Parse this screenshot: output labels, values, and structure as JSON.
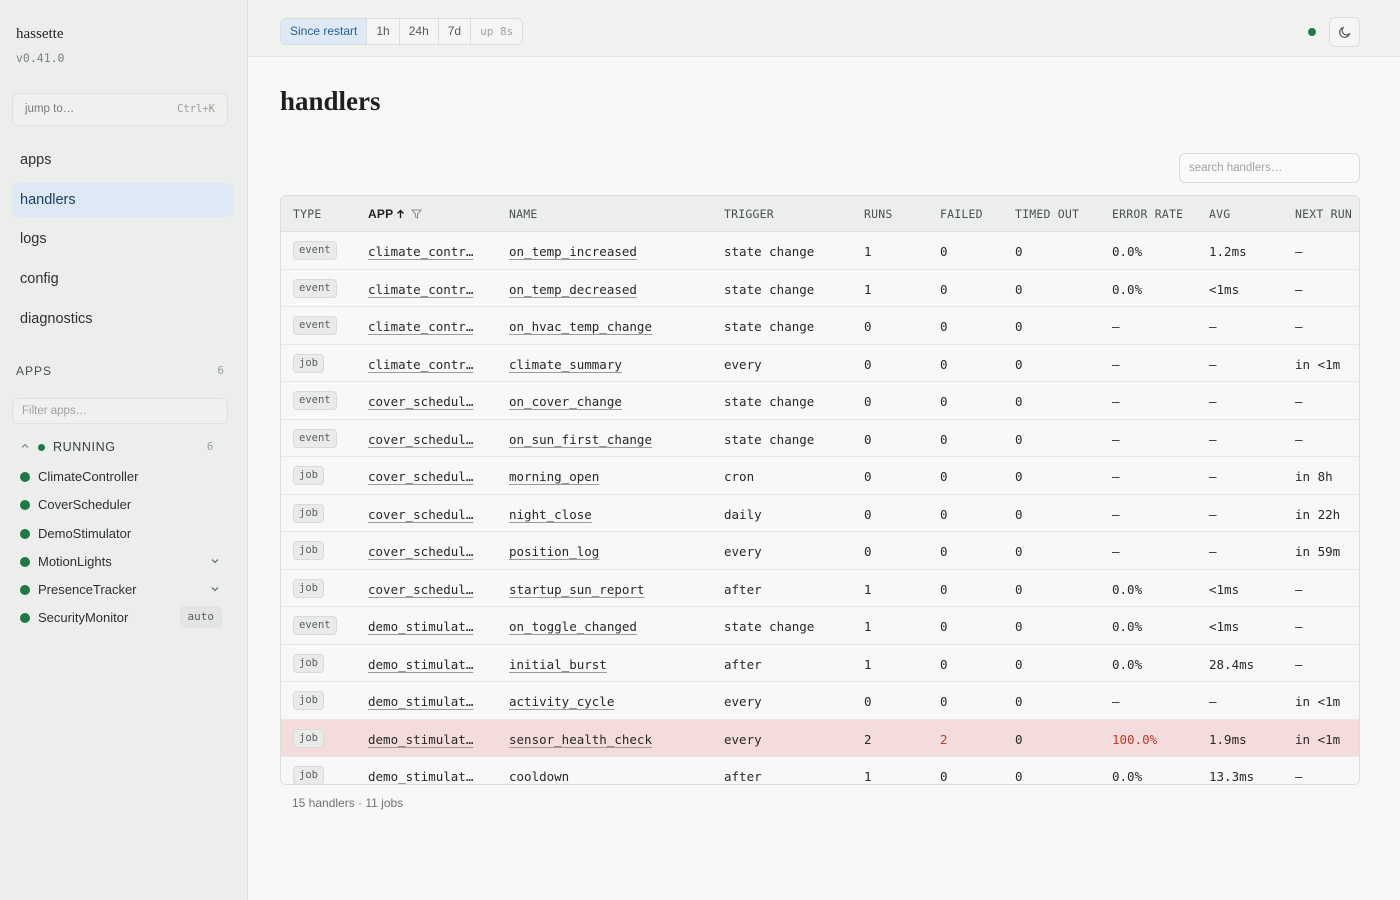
{
  "sidebar": {
    "brand": "hassette",
    "version": "v0.41.0",
    "jump_placeholder": "jump to…",
    "jump_shortcut": "Ctrl+K",
    "nav": [
      {
        "label": "apps",
        "active": false
      },
      {
        "label": "handlers",
        "active": true
      },
      {
        "label": "logs",
        "active": false
      },
      {
        "label": "config",
        "active": false
      },
      {
        "label": "diagnostics",
        "active": false
      }
    ],
    "apps_header": "APPS",
    "apps_count": "6",
    "filter_placeholder": "Filter apps…",
    "group": {
      "label": "RUNNING",
      "count": "6",
      "collapse_icon": "chevron-up-icon"
    },
    "apps": [
      {
        "name": "ClimateController",
        "status_color": "#1e7a45",
        "expand": false,
        "badge": ""
      },
      {
        "name": "CoverScheduler",
        "status_color": "#1e7a45",
        "expand": false,
        "badge": ""
      },
      {
        "name": "DemoStimulator",
        "status_color": "#1e7a45",
        "expand": false,
        "badge": ""
      },
      {
        "name": "MotionLights",
        "status_color": "#1e7a45",
        "expand": true,
        "badge": ""
      },
      {
        "name": "PresenceTracker",
        "status_color": "#1e7a45",
        "expand": true,
        "badge": ""
      },
      {
        "name": "SecurityMonitor",
        "status_color": "#1e7a45",
        "expand": false,
        "badge": "auto"
      }
    ]
  },
  "topbar": {
    "ranges": [
      "Since restart",
      "1h",
      "24h",
      "7d"
    ],
    "active_range": "Since restart",
    "uptime": "up 8s",
    "connection_color": "#1e7a45",
    "theme_icon": "moon-icon"
  },
  "page": {
    "title": "handlers",
    "search_placeholder": "search handlers…",
    "footer": "15 handlers · 11 jobs"
  },
  "table": {
    "columns": [
      "TYPE",
      "APP",
      "NAME",
      "TRIGGER",
      "RUNS",
      "FAILED",
      "TIMED OUT",
      "ERROR RATE",
      "AVG",
      "NEXT RUN"
    ],
    "sorted_column": "APP",
    "sort_icon": "arrow-up-icon",
    "filter_icon": "filter-icon",
    "error_color": "#c0392b",
    "rows": [
      {
        "type": "event",
        "app": "climate_contr…",
        "name": "on_temp_increased",
        "trigger": "state change",
        "runs": "1",
        "failed": "0",
        "timed_out": "0",
        "error_rate": "0.0%",
        "avg": "1.2ms",
        "next_run": "—",
        "error": false
      },
      {
        "type": "event",
        "app": "climate_contr…",
        "name": "on_temp_decreased",
        "trigger": "state change",
        "runs": "1",
        "failed": "0",
        "timed_out": "0",
        "error_rate": "0.0%",
        "avg": "<1ms",
        "next_run": "—",
        "error": false
      },
      {
        "type": "event",
        "app": "climate_contr…",
        "name": "on_hvac_temp_change",
        "trigger": "state change",
        "runs": "0",
        "failed": "0",
        "timed_out": "0",
        "error_rate": "—",
        "avg": "—",
        "next_run": "—",
        "error": false
      },
      {
        "type": "job",
        "app": "climate_contr…",
        "name": "climate_summary",
        "trigger": "every",
        "runs": "0",
        "failed": "0",
        "timed_out": "0",
        "error_rate": "—",
        "avg": "—",
        "next_run": "in <1m",
        "error": false
      },
      {
        "type": "event",
        "app": "cover_schedul…",
        "name": "on_cover_change",
        "trigger": "state change",
        "runs": "0",
        "failed": "0",
        "timed_out": "0",
        "error_rate": "—",
        "avg": "—",
        "next_run": "—",
        "error": false
      },
      {
        "type": "event",
        "app": "cover_schedul…",
        "name": "on_sun_first_change",
        "trigger": "state change",
        "runs": "0",
        "failed": "0",
        "timed_out": "0",
        "error_rate": "—",
        "avg": "—",
        "next_run": "—",
        "error": false
      },
      {
        "type": "job",
        "app": "cover_schedul…",
        "name": "morning_open",
        "trigger": "cron",
        "runs": "0",
        "failed": "0",
        "timed_out": "0",
        "error_rate": "—",
        "avg": "—",
        "next_run": "in 8h",
        "error": false
      },
      {
        "type": "job",
        "app": "cover_schedul…",
        "name": "night_close",
        "trigger": "daily",
        "runs": "0",
        "failed": "0",
        "timed_out": "0",
        "error_rate": "—",
        "avg": "—",
        "next_run": "in 22h",
        "error": false
      },
      {
        "type": "job",
        "app": "cover_schedul…",
        "name": "position_log",
        "trigger": "every",
        "runs": "0",
        "failed": "0",
        "timed_out": "0",
        "error_rate": "—",
        "avg": "—",
        "next_run": "in 59m",
        "error": false
      },
      {
        "type": "job",
        "app": "cover_schedul…",
        "name": "startup_sun_report",
        "trigger": "after",
        "runs": "1",
        "failed": "0",
        "timed_out": "0",
        "error_rate": "0.0%",
        "avg": "<1ms",
        "next_run": "—",
        "error": false
      },
      {
        "type": "event",
        "app": "demo_stimulat…",
        "name": "on_toggle_changed",
        "trigger": "state change",
        "runs": "1",
        "failed": "0",
        "timed_out": "0",
        "error_rate": "0.0%",
        "avg": "<1ms",
        "next_run": "—",
        "error": false
      },
      {
        "type": "job",
        "app": "demo_stimulat…",
        "name": "initial_burst",
        "trigger": "after",
        "runs": "1",
        "failed": "0",
        "timed_out": "0",
        "error_rate": "0.0%",
        "avg": "28.4ms",
        "next_run": "—",
        "error": false
      },
      {
        "type": "job",
        "app": "demo_stimulat…",
        "name": "activity_cycle",
        "trigger": "every",
        "runs": "0",
        "failed": "0",
        "timed_out": "0",
        "error_rate": "—",
        "avg": "—",
        "next_run": "in <1m",
        "error": false
      },
      {
        "type": "job",
        "app": "demo_stimulat…",
        "name": "sensor_health_check",
        "trigger": "every",
        "runs": "2",
        "failed": "2",
        "timed_out": "0",
        "error_rate": "100.0%",
        "avg": "1.9ms",
        "next_run": "in <1m",
        "error": true
      },
      {
        "type": "job",
        "app": "demo_stimulat…",
        "name": "cooldown",
        "trigger": "after",
        "runs": "1",
        "failed": "0",
        "timed_out": "0",
        "error_rate": "0.0%",
        "avg": "13.3ms",
        "next_run": "—",
        "error": false
      }
    ]
  }
}
